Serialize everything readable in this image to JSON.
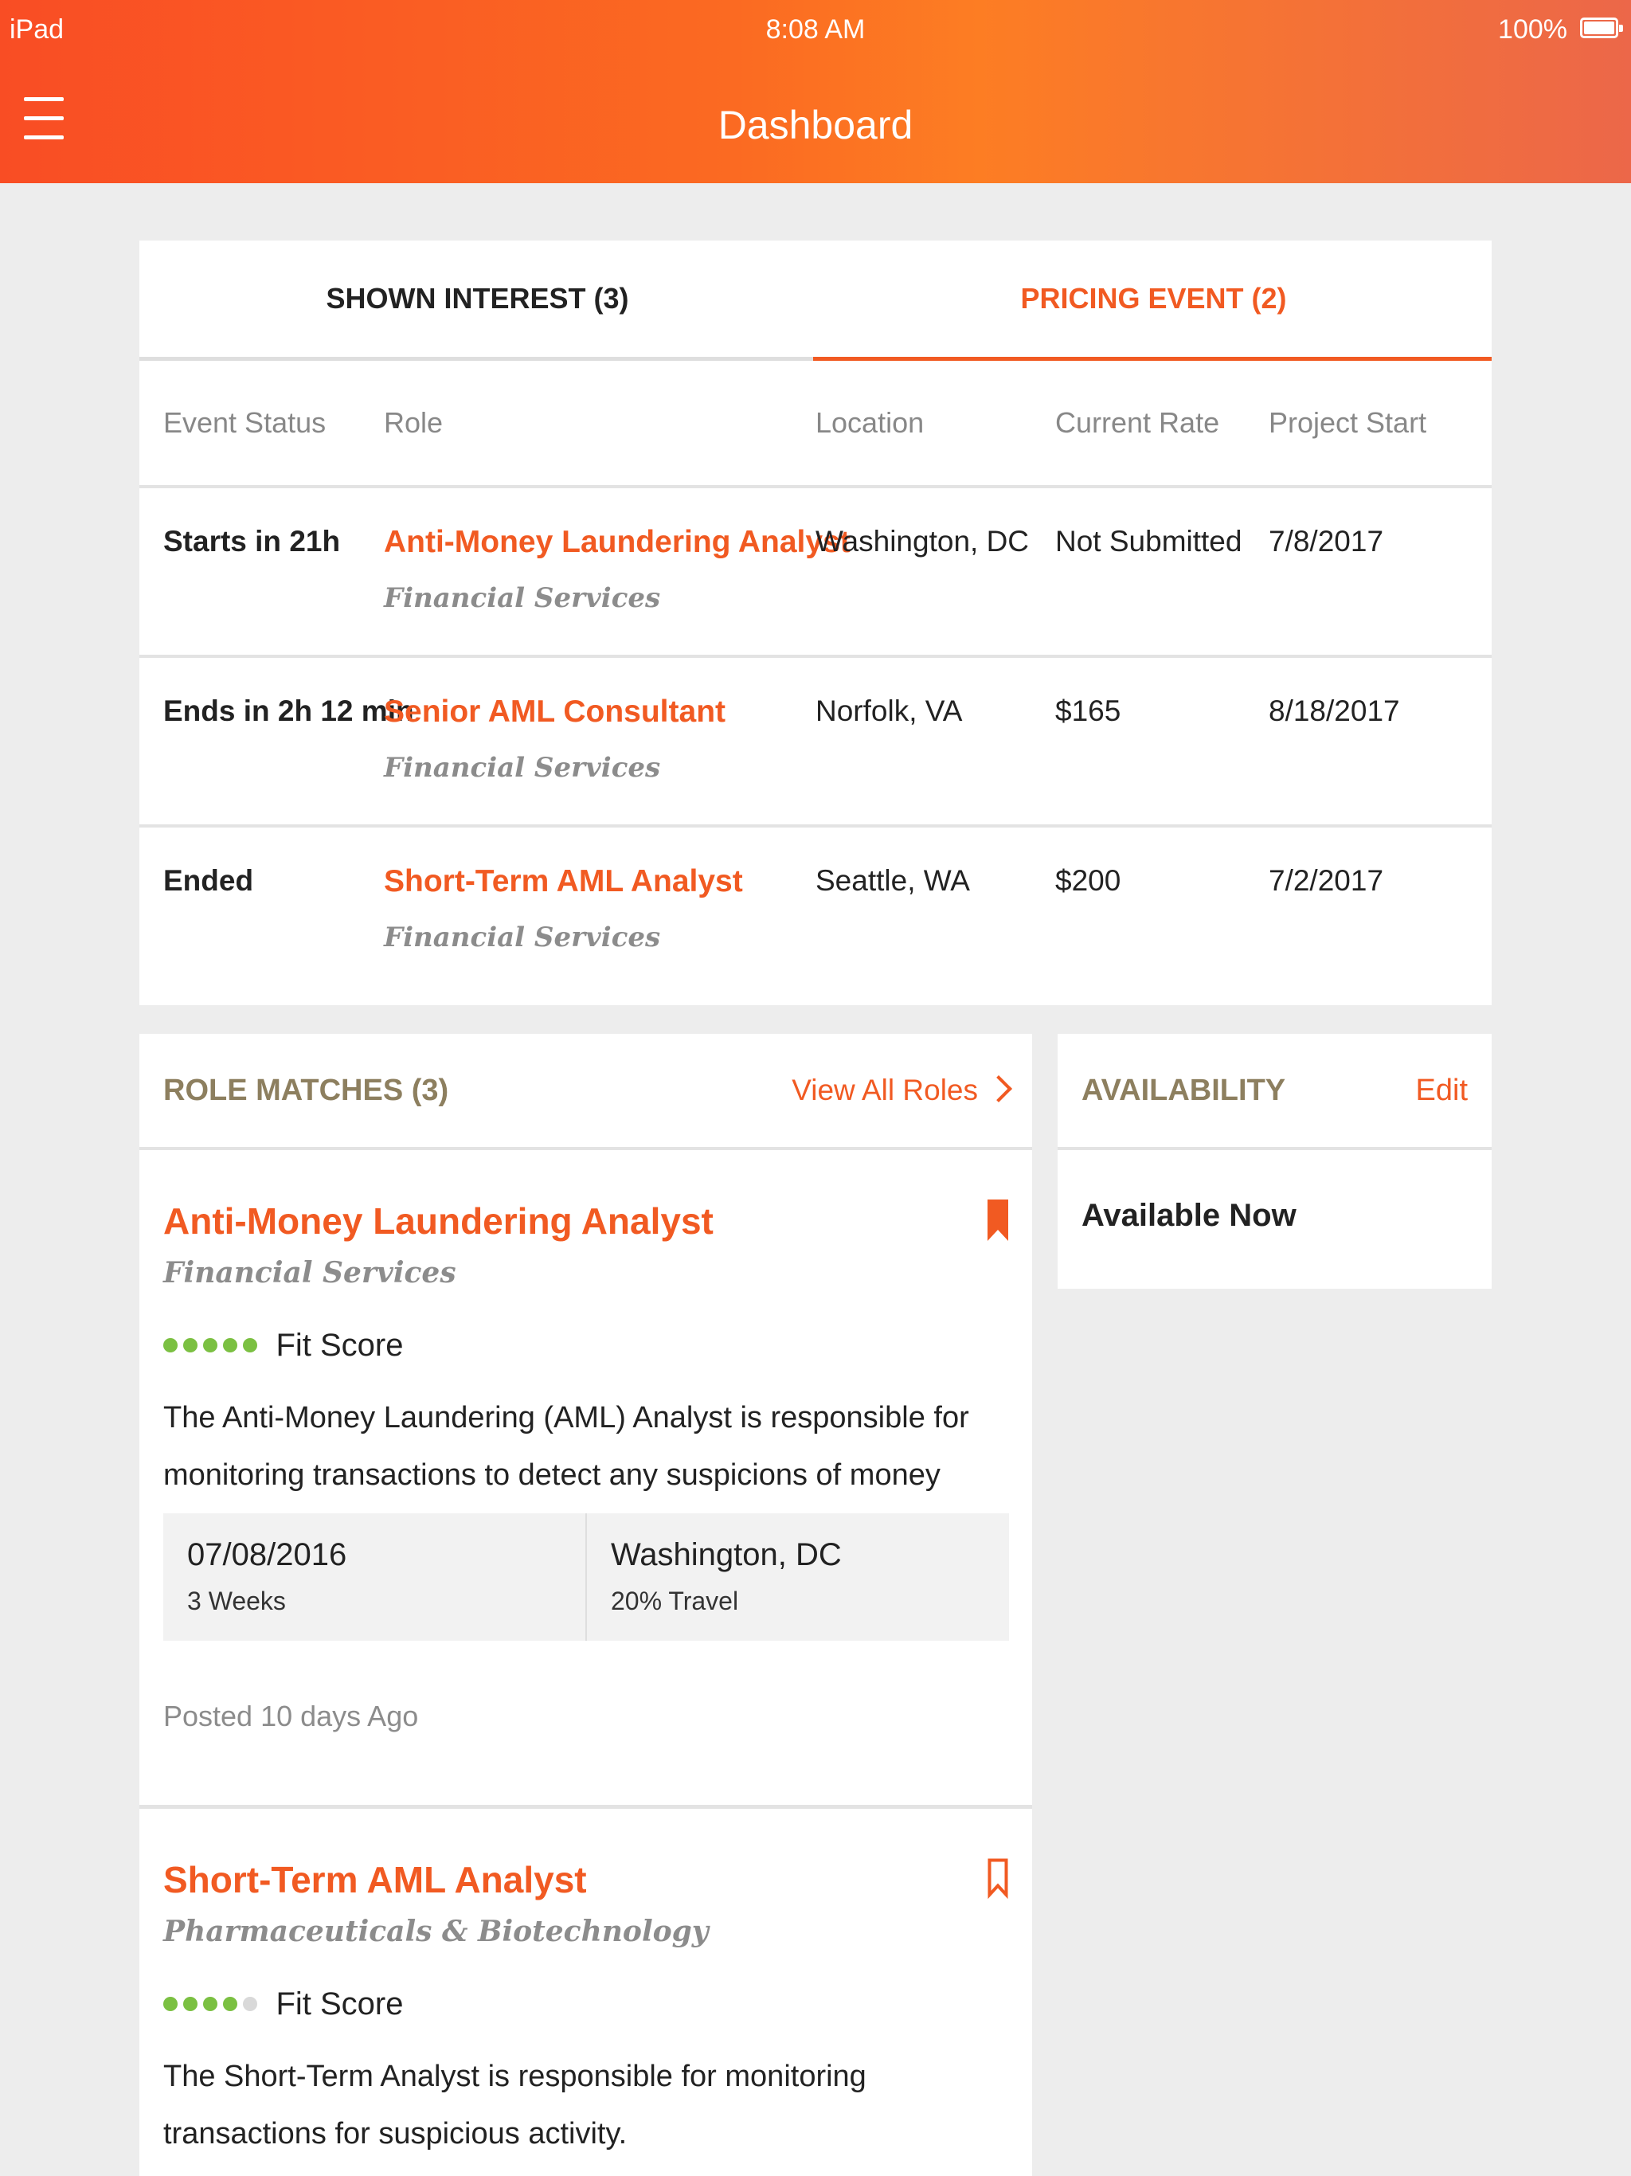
{
  "status_bar": {
    "device": "iPad",
    "time": "8:08 AM",
    "battery": "100%"
  },
  "header": {
    "title": "Dashboard"
  },
  "pricing": {
    "tabs": [
      {
        "label": "SHOWN INTEREST (3)",
        "active": false
      },
      {
        "label": "PRICING EVENT (2)",
        "active": true
      }
    ],
    "columns": [
      "Event Status",
      "Role",
      "Location",
      "Current Rate",
      "Project Start"
    ],
    "rows": [
      {
        "status": "Starts in 21h",
        "role": "Anti-Money Laundering Analyst",
        "industry": "Financial Services",
        "location": "Washington, DC",
        "rate": "Not Submitted",
        "start": "7/8/2017"
      },
      {
        "status": "Ends in 2h 12 min",
        "role": "Senior AML Consultant",
        "industry": "Financial Services",
        "location": "Norfolk, VA",
        "rate": "$165",
        "start": "8/18/2017"
      },
      {
        "status": "Ended",
        "role": "Short-Term AML Analyst",
        "industry": "Financial Services",
        "location": "Seattle, WA",
        "rate": "$200",
        "start": "7/2/2017"
      }
    ]
  },
  "role_matches": {
    "title": "ROLE MATCHES (3)",
    "view_all": "View All Roles",
    "jobs": [
      {
        "title": "Anti-Money Laundering Analyst",
        "industry": "Financial Services",
        "fit_score": 5,
        "fit_label": "Fit Score",
        "bookmarked": true,
        "description": "The Anti-Money Laundering (AML) Analyst is responsible for monitoring transactions to detect any suspicions of money laundering.",
        "start_date": "07/08/2016",
        "duration": "3 Weeks",
        "location": "Washington, DC",
        "travel": "20% Travel",
        "posted": "Posted 10 days Ago"
      },
      {
        "title": "Short-Term AML Analyst",
        "industry": "Pharmaceuticals & Biotechnology",
        "fit_score": 4,
        "fit_label": "Fit Score",
        "bookmarked": false,
        "description": "The Short-Term Analyst is responsible for monitoring transactions for suspicious activity."
      }
    ]
  },
  "availability": {
    "title": "AVAILABILITY",
    "edit": "Edit",
    "value": "Available Now"
  },
  "colors": {
    "accent": "#f15a22",
    "fit_dot": "#7bc042",
    "section_title": "#8d7f5f"
  }
}
